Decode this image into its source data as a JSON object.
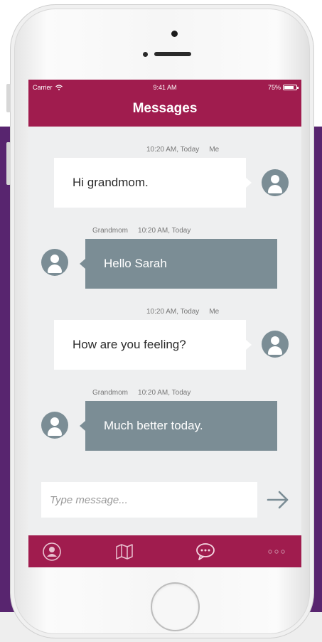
{
  "status_bar": {
    "carrier": "Carrier",
    "time": "9:41 AM",
    "battery": "75%"
  },
  "header": {
    "title": "Messages"
  },
  "messages": [
    {
      "sender": "Me",
      "time": "10:20 AM, Today",
      "text": "Hi grandmom."
    },
    {
      "sender": "Grandmom",
      "time": "10:20 AM, Today",
      "text": "Hello Sarah"
    },
    {
      "sender": "Me",
      "time": "10:20 AM, Today",
      "text": "How are you feeling?"
    },
    {
      "sender": "Grandmom",
      "time": "10:20 AM, Today",
      "text": "Much better today."
    }
  ],
  "composer": {
    "placeholder": "Type message...",
    "send_icon": "arrow-right-icon"
  },
  "tabbar": {
    "items": [
      {
        "icon": "profile-icon"
      },
      {
        "icon": "map-icon"
      },
      {
        "icon": "chat-icon"
      },
      {
        "icon": "more-icon"
      }
    ]
  },
  "colors": {
    "brand": "#a01c4e",
    "background_purple": "#58256f",
    "received_bubble": "#7b8d95",
    "sent_bubble": "#ffffff",
    "screen_background": "#eeeff0"
  }
}
